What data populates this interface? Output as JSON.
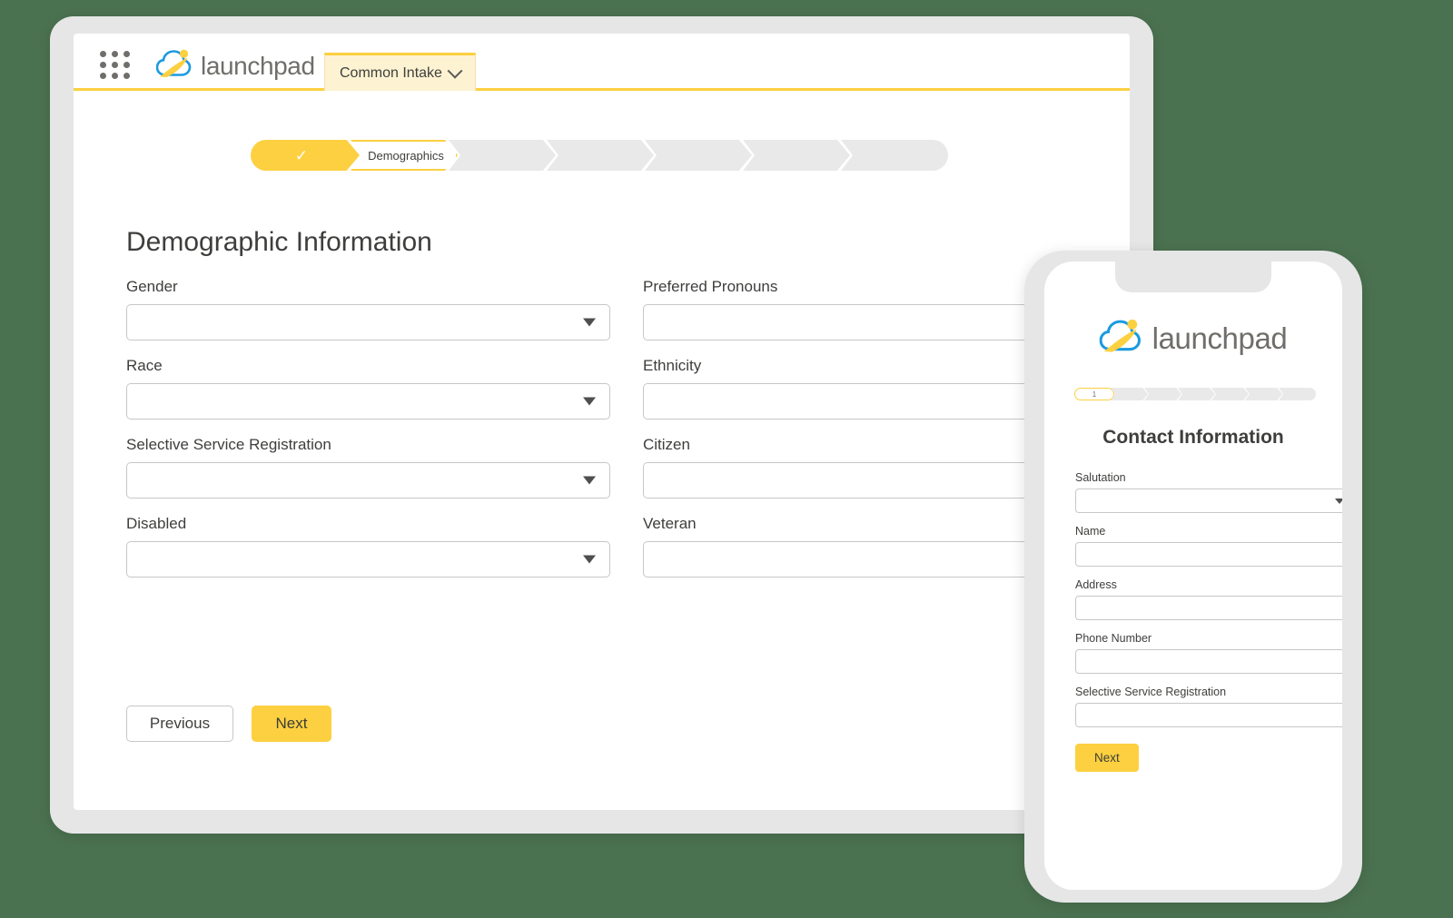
{
  "background_color": "#4b7250",
  "accent_color": "#fcd040",
  "desktop": {
    "topbar": {
      "app_launcher_icon": "app-launcher-grid-icon",
      "brand_name": "launchpad",
      "brand_logo_icon": "launchpad-logo-icon",
      "tab_label": "Common Intake",
      "tab_chevron_icon": "chevron-down-icon"
    },
    "progress": {
      "steps": [
        {
          "label": "",
          "state": "done",
          "icon": "check-icon"
        },
        {
          "label": "Demographics",
          "state": "active"
        },
        {
          "label": "",
          "state": "todo"
        },
        {
          "label": "",
          "state": "todo"
        },
        {
          "label": "",
          "state": "todo"
        },
        {
          "label": "",
          "state": "todo"
        },
        {
          "label": "",
          "state": "todo"
        }
      ]
    },
    "section_title": "Demographic Information",
    "fields": [
      {
        "label": "Gender",
        "value": "",
        "type": "select"
      },
      {
        "label": "Preferred Pronouns",
        "value": "",
        "type": "text"
      },
      {
        "label": "Race",
        "value": "",
        "type": "select"
      },
      {
        "label": "Ethnicity",
        "value": "",
        "type": "text"
      },
      {
        "label": "Selective Service Registration",
        "value": "",
        "type": "select"
      },
      {
        "label": "Citizen",
        "value": "",
        "type": "text"
      },
      {
        "label": "Disabled",
        "value": "",
        "type": "select"
      },
      {
        "label": "Veteran",
        "value": "",
        "type": "text"
      }
    ],
    "actions": {
      "previous_label": "Previous",
      "next_label": "Next"
    }
  },
  "mobile": {
    "brand_name": "launchpad",
    "brand_logo_icon": "launchpad-logo-icon",
    "progress": {
      "steps": [
        {
          "label": "1",
          "state": "active"
        },
        {
          "label": "",
          "state": "todo"
        },
        {
          "label": "",
          "state": "todo"
        },
        {
          "label": "",
          "state": "todo"
        },
        {
          "label": "",
          "state": "todo"
        },
        {
          "label": "",
          "state": "todo"
        },
        {
          "label": "",
          "state": "todo"
        }
      ]
    },
    "title": "Contact Information",
    "fields": [
      {
        "label": "Salutation",
        "value": "",
        "type": "select"
      },
      {
        "label": "Name",
        "value": "",
        "type": "text"
      },
      {
        "label": "Address",
        "value": "",
        "type": "text"
      },
      {
        "label": "Phone Number",
        "value": "",
        "type": "text"
      },
      {
        "label": "Selective Service Registration",
        "value": "",
        "type": "text"
      }
    ],
    "actions": {
      "next_label": "Next"
    }
  }
}
